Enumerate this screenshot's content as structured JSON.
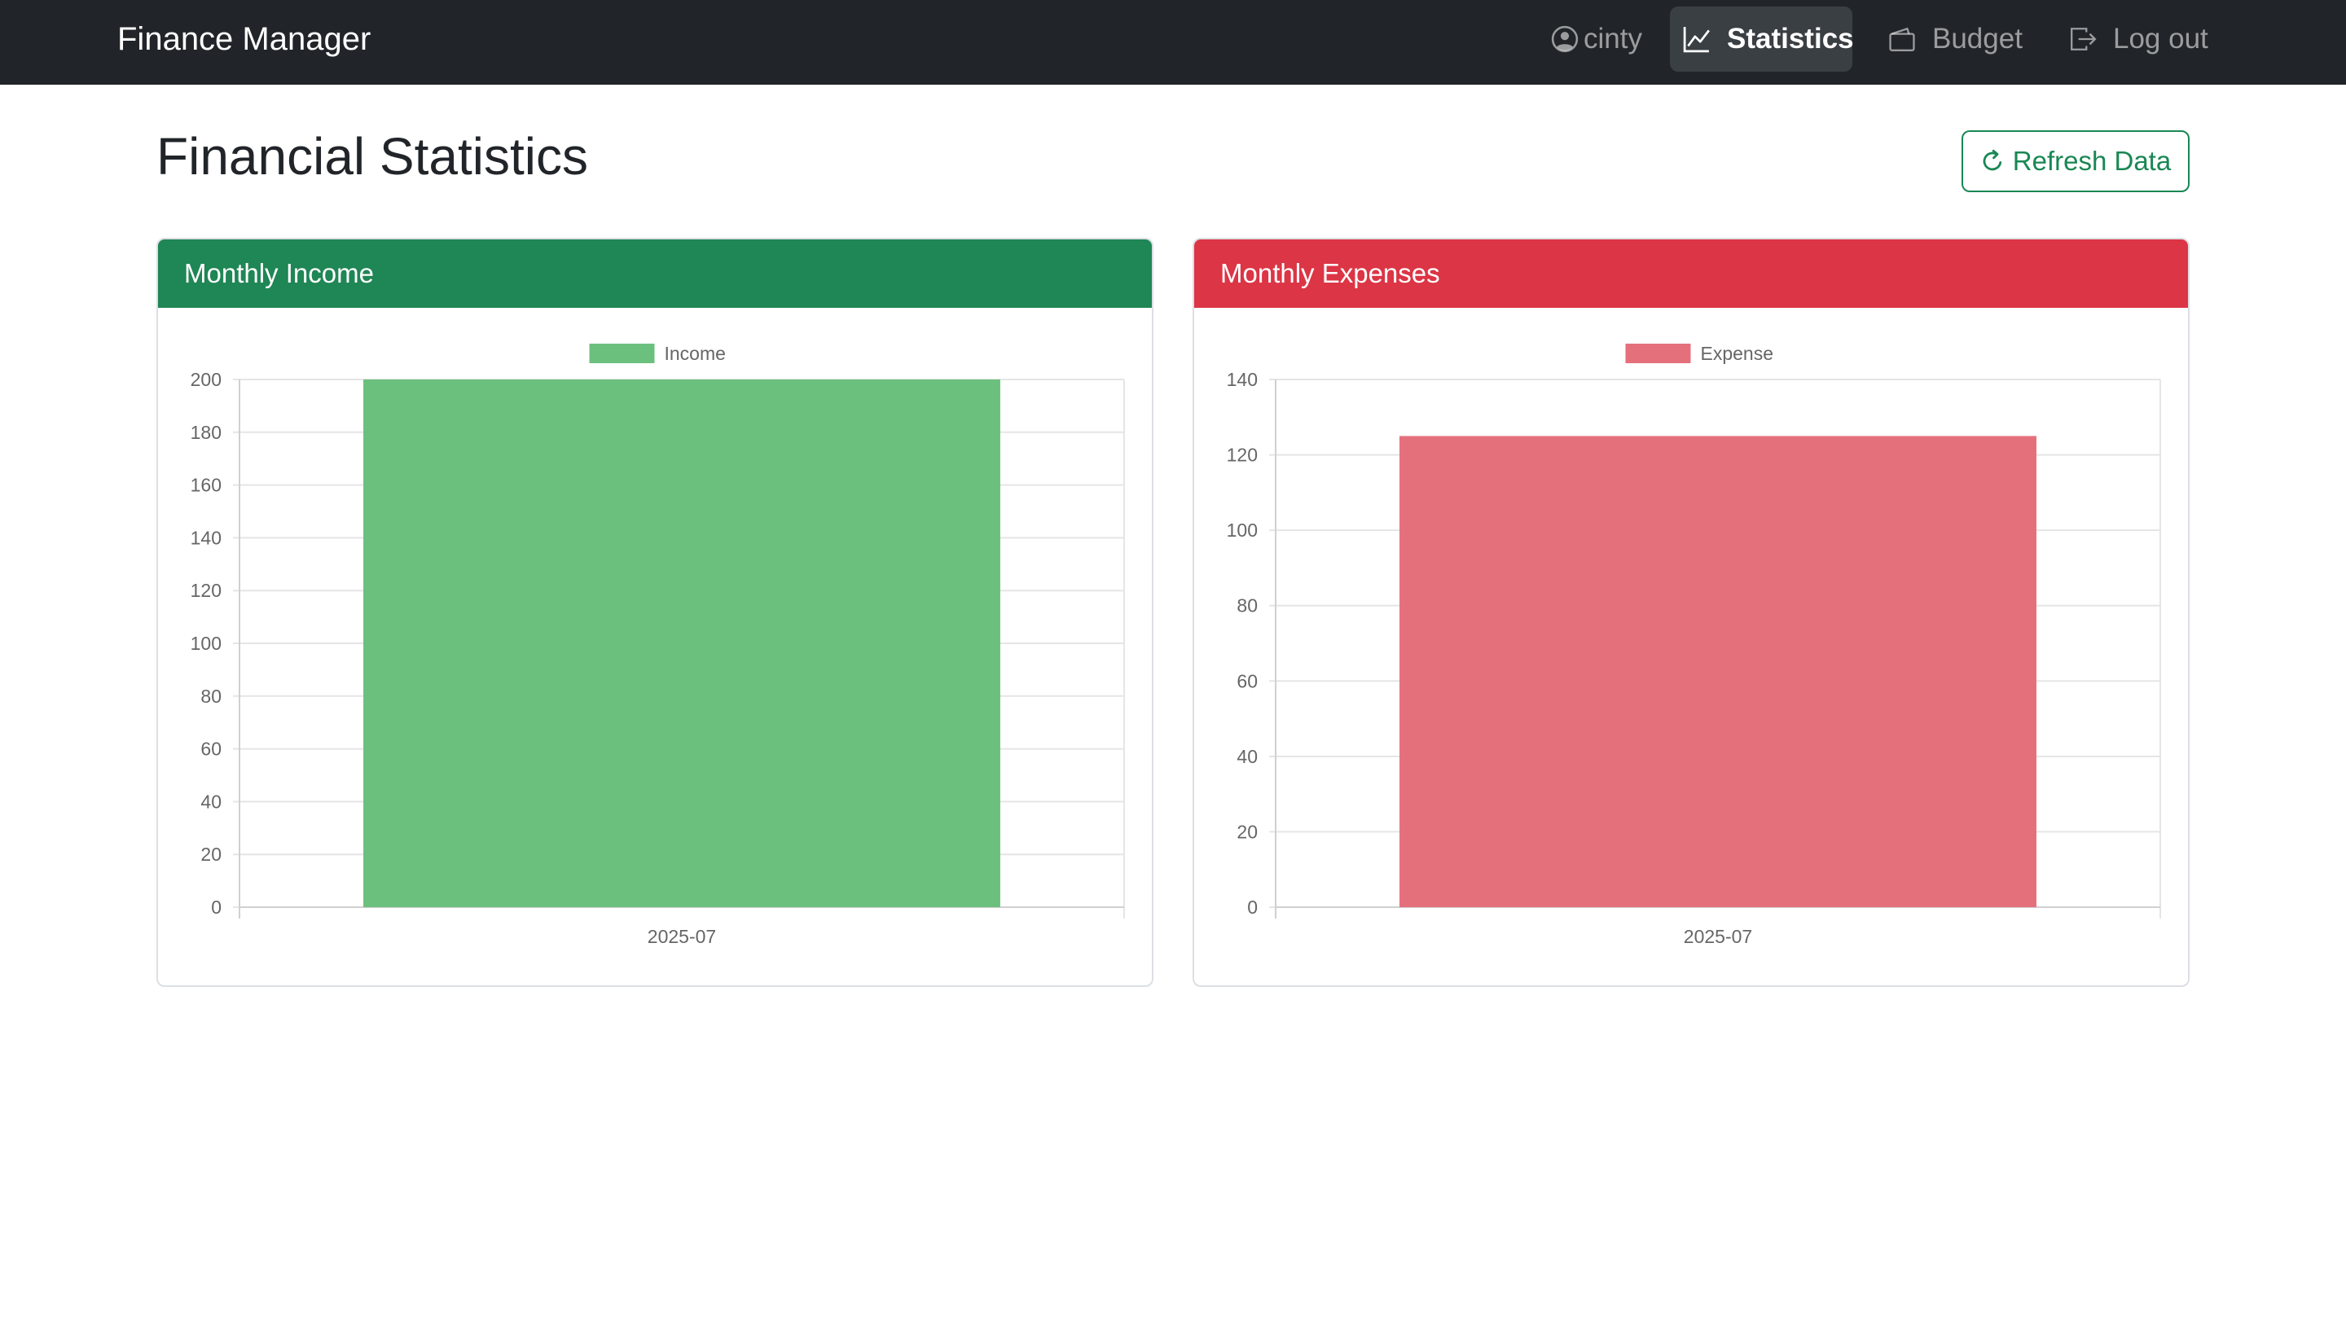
{
  "navbar": {
    "brand": "Finance Manager",
    "user": {
      "label": "cinty",
      "icon": "person-circle-icon"
    },
    "statistics": {
      "label": "Statistics",
      "icon": "graph-up-icon"
    },
    "budget": {
      "label": "Budget",
      "icon": "wallet-icon"
    },
    "logout": {
      "label": "Log out",
      "icon": "box-arrow-right-icon"
    }
  },
  "page": {
    "title": "Financial Statistics",
    "refresh_label": "Refresh Data",
    "refresh_icon": "arrow-clockwise-icon"
  },
  "colors": {
    "income_header": "#1f8655",
    "expense_header": "#dc3545",
    "income_bar": "#6cc07d",
    "expense_bar": "#e4707c",
    "navbar": "#212529"
  },
  "income_card": {
    "title": "Monthly Income"
  },
  "expense_card": {
    "title": "Monthly Expenses"
  },
  "chart_data": [
    {
      "type": "bar",
      "title": "",
      "categories": [
        "2025-07"
      ],
      "series": [
        {
          "name": "Income",
          "values": [
            200
          ]
        }
      ],
      "ylim": [
        0,
        200
      ],
      "yticks": [
        "0",
        "20",
        "40",
        "60",
        "80",
        "100",
        "120",
        "140",
        "160",
        "180",
        "200"
      ],
      "grid": true,
      "legend": "top-center"
    },
    {
      "type": "bar",
      "title": "",
      "categories": [
        "2025-07"
      ],
      "series": [
        {
          "name": "Expense",
          "values": [
            125
          ]
        }
      ],
      "ylim": [
        0,
        140
      ],
      "yticks": [
        "0",
        "20",
        "40",
        "60",
        "80",
        "100",
        "120",
        "140"
      ],
      "grid": true,
      "legend": "top-center"
    }
  ]
}
